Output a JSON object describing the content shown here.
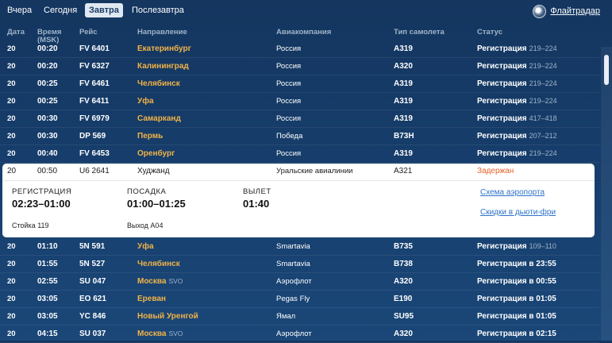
{
  "tabs": {
    "yesterday": "Вчера",
    "today": "Сегодня",
    "tomorrow": "Завтра",
    "after_tomorrow": "Послезавтра"
  },
  "flightradar": {
    "label": "Флайтрадар",
    "icon": "radar-logo-icon"
  },
  "columns": {
    "date": "Дата",
    "time_line1": "Время",
    "time_line2": "(MSK)",
    "flight": "Рейс",
    "destination": "Направление",
    "airline": "Авиакомпания",
    "aircraft": "Тип самолета",
    "status": "Статус"
  },
  "rows_top": [
    {
      "date": "20",
      "time": "00:20",
      "flight": "FV 6401",
      "destination": "Екатеринбург",
      "airline": "Россия",
      "aircraft": "A319",
      "status": "Регистрация",
      "status_times": "219–224"
    },
    {
      "date": "20",
      "time": "00:20",
      "flight": "FV 6327",
      "destination": "Калининград",
      "airline": "Россия",
      "aircraft": "A320",
      "status": "Регистрация",
      "status_times": "219–224"
    },
    {
      "date": "20",
      "time": "00:25",
      "flight": "FV 6461",
      "destination": "Челябинск",
      "airline": "Россия",
      "aircraft": "A319",
      "status": "Регистрация",
      "status_times": "219–224"
    },
    {
      "date": "20",
      "time": "00:25",
      "flight": "FV 6411",
      "destination": "Уфа",
      "airline": "Россия",
      "aircraft": "A319",
      "status": "Регистрация",
      "status_times": "219–224"
    },
    {
      "date": "20",
      "time": "00:30",
      "flight": "FV 6979",
      "destination": "Самарканд",
      "airline": "Россия",
      "aircraft": "A319",
      "status": "Регистрация",
      "status_times": "417–418"
    },
    {
      "date": "20",
      "time": "00:30",
      "flight": "DP 569",
      "destination": "Пермь",
      "airline": "Победа",
      "aircraft": "B73H",
      "status": "Регистрация",
      "status_times": "207–212"
    },
    {
      "date": "20",
      "time": "00:40",
      "flight": "FV 6453",
      "destination": "Оренбург",
      "airline": "Россия",
      "aircraft": "A319",
      "status": "Регистрация",
      "status_times": "219–224"
    }
  ],
  "expanded": {
    "date": "20",
    "time": "00:50",
    "flight": "U6 2641",
    "destination": "Худжанд",
    "airline": "Уральские авиалинии",
    "aircraft": "A321",
    "status": "Задержан",
    "status_color": "#e8622a",
    "checkin_label": "РЕГИСТРАЦИЯ",
    "checkin_value": "02:23–01:00",
    "boarding_label": "ПОСАДКА",
    "boarding_value": "01:00–01:25",
    "departure_label": "ВЫЛЕТ",
    "departure_value": "01:40",
    "counter": "Стойка 119",
    "gate": "Выход A04",
    "airport_map_link": "Схема аэропорта",
    "duty_free_link": "Скидки в дьюти-фри"
  },
  "rows_bottom": [
    {
      "date": "20",
      "time": "01:10",
      "flight": "5N 591",
      "destination": "Уфа",
      "suffix": "",
      "airline": "Smartavia",
      "aircraft": "B735",
      "status": "Регистрация",
      "status_times": "109–110"
    },
    {
      "date": "20",
      "time": "01:55",
      "flight": "5N 527",
      "destination": "Челябинск",
      "suffix": "",
      "airline": "Smartavia",
      "aircraft": "B738",
      "status": "Регистрация в 23:55",
      "status_times": ""
    },
    {
      "date": "20",
      "time": "02:55",
      "flight": "SU 047",
      "destination": "Москва",
      "suffix": "SVO",
      "airline": "Аэрофлот",
      "aircraft": "A320",
      "status": "Регистрация в 00:55",
      "status_times": ""
    },
    {
      "date": "20",
      "time": "03:05",
      "flight": "EO 621",
      "destination": "Ереван",
      "suffix": "",
      "airline": "Pegas Fly",
      "aircraft": "E190",
      "status": "Регистрация в 01:05",
      "status_times": ""
    },
    {
      "date": "20",
      "time": "03:05",
      "flight": "YC 846",
      "destination": "Новый Уренгой",
      "suffix": "",
      "airline": "Ямал",
      "aircraft": "SU95",
      "status": "Регистрация в 01:05",
      "status_times": ""
    },
    {
      "date": "20",
      "time": "04:15",
      "flight": "SU 037",
      "destination": "Москва",
      "suffix": "SVO",
      "airline": "Аэрофлот",
      "aircraft": "A320",
      "status": "Регистрация в 02:15",
      "status_times": ""
    }
  ]
}
